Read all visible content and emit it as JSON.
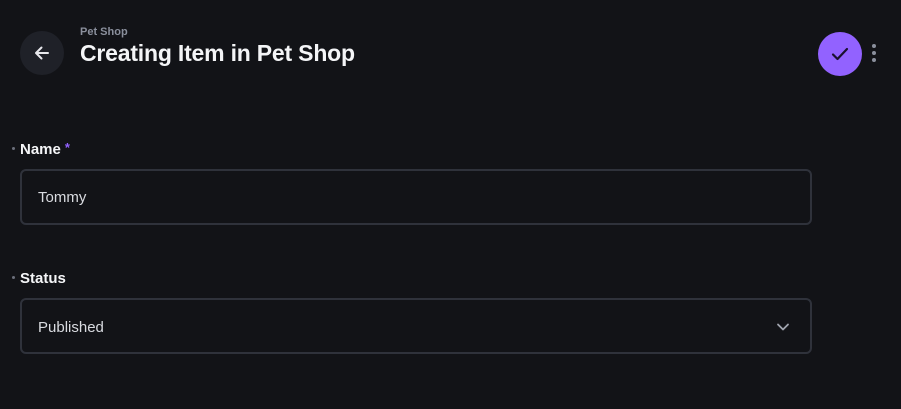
{
  "header": {
    "breadcrumb": "Pet Shop",
    "title": "Creating Item in Pet Shop",
    "back_icon": "arrow-left-icon",
    "save_icon": "check-icon",
    "more_icon": "more-vertical-icon"
  },
  "form": {
    "name": {
      "label": "Name",
      "required_mark": "*",
      "value": "Tommy"
    },
    "status": {
      "label": "Status",
      "selected": "Published",
      "dropdown_icon": "chevron-down-icon"
    }
  },
  "colors": {
    "background": "#121317",
    "accent": "#9262ff",
    "border": "#2f323b",
    "muted_text": "#8a8f9c"
  }
}
